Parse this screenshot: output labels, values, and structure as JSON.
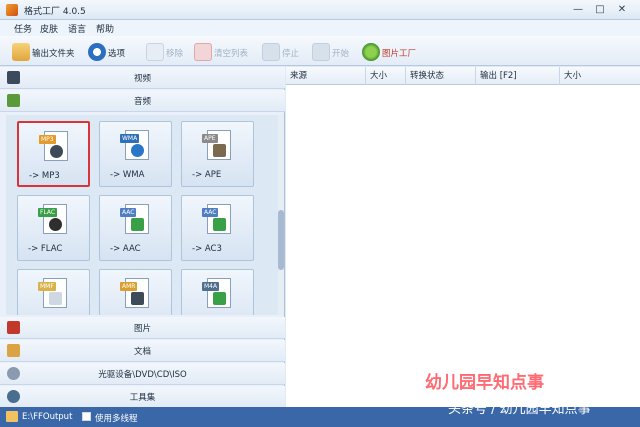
{
  "window": {
    "title": "格式工厂 4.0.5",
    "minimize": "—",
    "maximize": "□",
    "close": "✕"
  },
  "menu": [
    "任务",
    "皮肤",
    "语言",
    "帮助"
  ],
  "toolbar": {
    "output_folder": "输出文件夹",
    "options": "选项",
    "remove": "移除",
    "clear_list": "清空列表",
    "stop": "停止",
    "start": "开始",
    "picture_factory": "图片工厂"
  },
  "categories": {
    "top": [
      {
        "label": "视频",
        "icon": "video-icon",
        "color": "#3b4a5c"
      },
      {
        "label": "音频",
        "icon": "audio-icon",
        "color": "#5a9a3a"
      }
    ],
    "bottom": [
      {
        "label": "图片",
        "icon": "picture-icon",
        "color": "#c0392b"
      },
      {
        "label": "文档",
        "icon": "document-icon",
        "color": "#d9a441"
      },
      {
        "label": "光驱设备\\DVD\\CD\\ISO",
        "icon": "disc-icon",
        "color": "#8a9bb0"
      },
      {
        "label": "工具集",
        "icon": "tools-icon",
        "color": "#4a6e8f"
      }
    ]
  },
  "formats": [
    {
      "tag": "MP3",
      "label": "-> MP3",
      "tag_color": "#e39b2b",
      "sym_color": "#3d4a57",
      "selected": true
    },
    {
      "tag": "WMA",
      "label": "-> WMA",
      "tag_color": "#2f6fb8",
      "sym_color": "#2a77c8",
      "selected": false
    },
    {
      "tag": "APE",
      "label": "-> APE",
      "tag_color": "#8a8a8a",
      "sym_color": "#7a6a50",
      "selected": false
    },
    {
      "tag": "FLAC",
      "label": "-> FLAC",
      "tag_color": "#3aa048",
      "sym_color": "#2e2e2e",
      "selected": false
    },
    {
      "tag": "AAC",
      "label": "-> AAC",
      "tag_color": "#4f7fc0",
      "sym_color": "#3aa048",
      "selected": false
    },
    {
      "tag": "AAC",
      "label": "-> AC3",
      "tag_color": "#4f7fc0",
      "sym_color": "#3aa048",
      "selected": false
    },
    {
      "tag": "MMF",
      "label": "",
      "tag_color": "#d9b24a",
      "sym_color": "#cfd8e2",
      "selected": false
    },
    {
      "tag": "AMR",
      "label": "",
      "tag_color": "#d9a030",
      "sym_color": "#3d4a57",
      "selected": false
    },
    {
      "tag": "M4A",
      "label": "",
      "tag_color": "#4f6f8f",
      "sym_color": "#3aa048",
      "selected": false
    }
  ],
  "table_headers": [
    "来源",
    "大小",
    "转换状态",
    "输出 [F2]",
    "大小"
  ],
  "status": {
    "output_path": "E:\\FFOutput",
    "checkbox_label": "使用多线程"
  },
  "watermark": {
    "text": "幼儿园早知点事",
    "source": "头条号 / 幼儿园早知点事"
  }
}
